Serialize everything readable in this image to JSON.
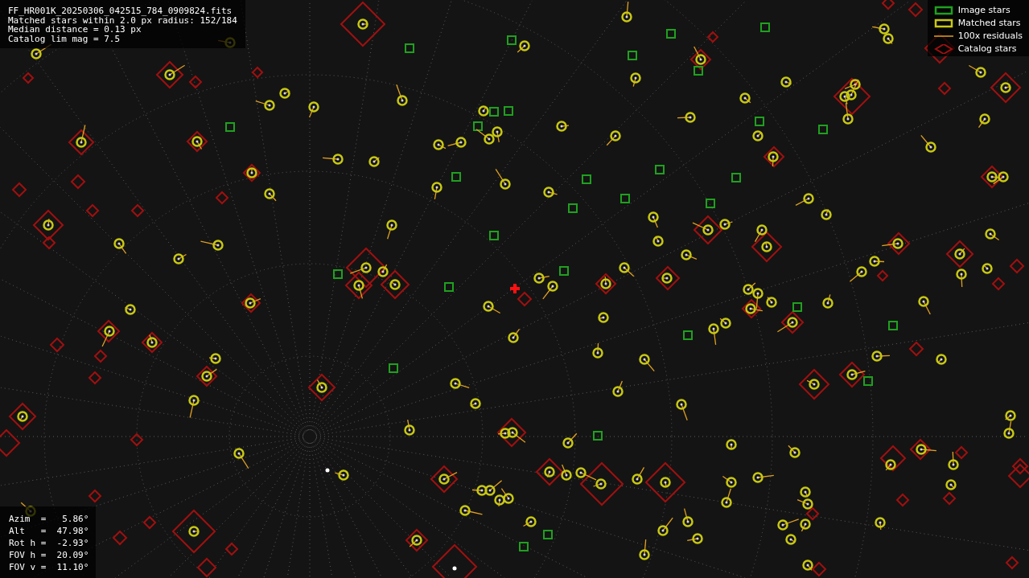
{
  "file_info": {
    "lines": [
      "FF_HR001K_20250306_042515_784_0909824.fits",
      "Matched stars within 2.0 px radius: 152/184",
      "Median distance = 0.13 px",
      "Catalog lim mag = 7.5"
    ]
  },
  "legend": [
    {
      "label": "Image stars",
      "kind": "image"
    },
    {
      "label": "Matched stars",
      "kind": "matched"
    },
    {
      "label": "100x residuals",
      "kind": "residual"
    },
    {
      "label": "Catalog stars",
      "kind": "catalog"
    }
  ],
  "pointing": {
    "lines": [
      "Azim  =   5.86°",
      "Alt   =  47.98°",
      "Rot h =  -2.93°",
      "FOV h =  20.09°",
      "FOV v =  11.10°"
    ]
  }
}
